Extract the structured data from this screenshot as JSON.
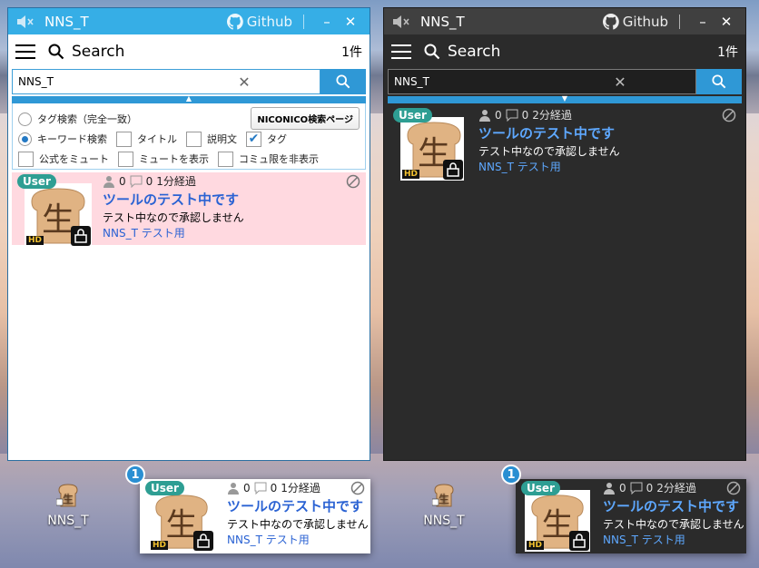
{
  "app_title": "NNS_T",
  "github_label": "Github",
  "toolbar": {
    "search_label": "Search",
    "count": "1件"
  },
  "search": {
    "value": "NNS_T"
  },
  "options": {
    "tag_search": "タグ検索（完全一致）",
    "keyword_search": "キーワード検索",
    "title": "タイトル",
    "description": "説明文",
    "tag": "タグ",
    "mute_official": "公式をミュート",
    "show_muted": "ミュートを表示",
    "hide_community_only": "コミュ限を非表示",
    "niconico_button": "NICONICO検索ページ"
  },
  "light_item": {
    "badge": "User",
    "viewers": "0",
    "comments": "0",
    "elapsed": "1分経過",
    "title": "ツールのテスト中です",
    "description": "テスト中なので承認しません",
    "owner": "NNS_T テスト用",
    "hd": "HD"
  },
  "dark_item": {
    "badge": "User",
    "viewers": "0",
    "comments": "0",
    "elapsed": "2分経過",
    "title": "ツールのテスト中です",
    "description": "テスト中なので承認しません",
    "owner": "NNS_T テスト用",
    "hd": "HD"
  },
  "desktop_icon_label": "NNS_T",
  "notification_count": "1",
  "colors": {
    "accent": "#36aee6",
    "dark_bg": "#2b2b2b",
    "highlight_bg": "#ffd9e0",
    "badge_green": "#2e9e93"
  }
}
